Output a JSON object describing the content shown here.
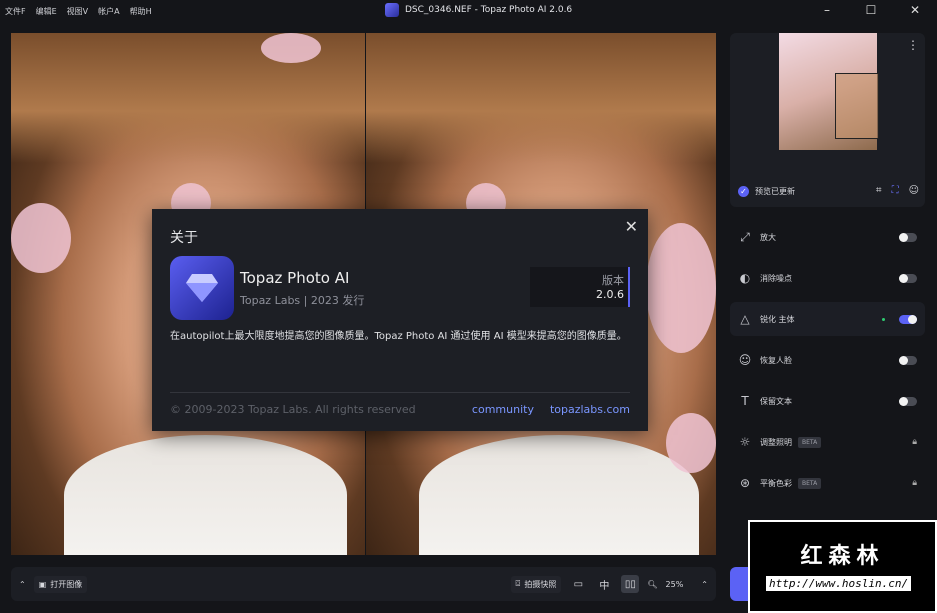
{
  "menu": [
    "文件F",
    "编辑E",
    "视图V",
    "帐户A",
    "帮助H"
  ],
  "window_title": "DSC_0346.NEF - Topaz Photo AI 2.0.6",
  "preview": {
    "status": "预览已更新"
  },
  "features": [
    {
      "label": "放大",
      "icon": "upscale-icon",
      "state": "off"
    },
    {
      "label": "消除噪点",
      "icon": "denoise-icon",
      "state": "off"
    },
    {
      "label": "锐化 主体",
      "icon": "sharpen-icon",
      "state": "on"
    },
    {
      "label": "恢复人脸",
      "icon": "face-icon",
      "state": "off"
    },
    {
      "label": "保留文本",
      "icon": "text-icon",
      "state": "off"
    },
    {
      "label": "调整照明",
      "icon": "light-icon",
      "badge": "BETA",
      "state": "locked"
    },
    {
      "label": "平衡色彩",
      "icon": "color-icon",
      "badge": "BETA",
      "state": "locked"
    }
  ],
  "bottom": {
    "open_image": "打开图像",
    "snapshot": "拍摄快照",
    "zoom": "25%"
  },
  "about": {
    "title": "关于",
    "app_name": "Topaz Photo AI",
    "publisher": "Topaz Labs | 2023 发行",
    "version_label": "版本",
    "version": "2.0.6",
    "description": "在autopilot上最大限度地提高您的图像质量。Topaz Photo AI 通过使用 AI 模型来提高您的图像质量。",
    "copyright": "© 2009-2023 Topaz Labs. All rights reserved",
    "link_community": "community",
    "link_site": "topazlabs.com"
  },
  "watermark": {
    "title": "红森林",
    "url": "http://www.hoslin.cn/"
  },
  "colors": {
    "accent": "#5b62f5"
  }
}
